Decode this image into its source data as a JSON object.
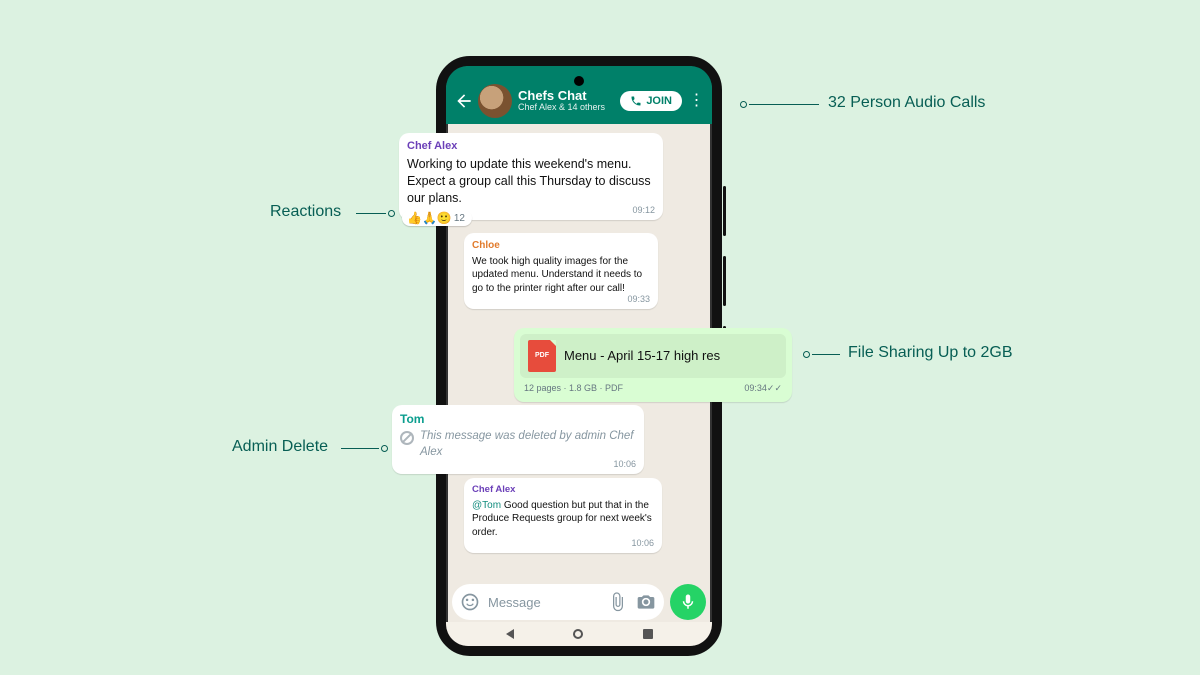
{
  "header": {
    "title": "Chefs Chat",
    "subtitle": "Chef Alex & 14 others",
    "join_label": "JOIN"
  },
  "messages": {
    "alex1": {
      "name": "Chef Alex",
      "body": "Working to update this weekend's menu. Expect a group call this Thursday to discuss our plans.",
      "time": "09:12"
    },
    "reactions": {
      "emoji1": "👍",
      "emoji2": "🙏",
      "emoji3": "🙂",
      "count": "12"
    },
    "chloe": {
      "name": "Chloe",
      "body": "We took high quality images for the updated menu. Understand it needs to go to the printer right after our call!",
      "time": "09:33"
    },
    "file": {
      "pdf_label": "PDF",
      "name": "Menu - April 15-17 high res",
      "meta": "12 pages · 1.8 GB · PDF",
      "time": "09:34",
      "checks": "✓✓"
    },
    "tom": {
      "name": "Tom",
      "body": "This message was deleted by admin Chef Alex",
      "time": "10:06"
    },
    "alex2": {
      "name": "Chef Alex",
      "mention": "@Tom",
      "body": " Good question but put that in the Produce Requests group for next week's order.",
      "time": "10:06"
    }
  },
  "composer": {
    "placeholder": "Message"
  },
  "callouts": {
    "reactions": "Reactions",
    "admin_delete": "Admin Delete",
    "audio_calls": "32 Person Audio Calls",
    "file_sharing": "File Sharing Up to 2GB"
  }
}
